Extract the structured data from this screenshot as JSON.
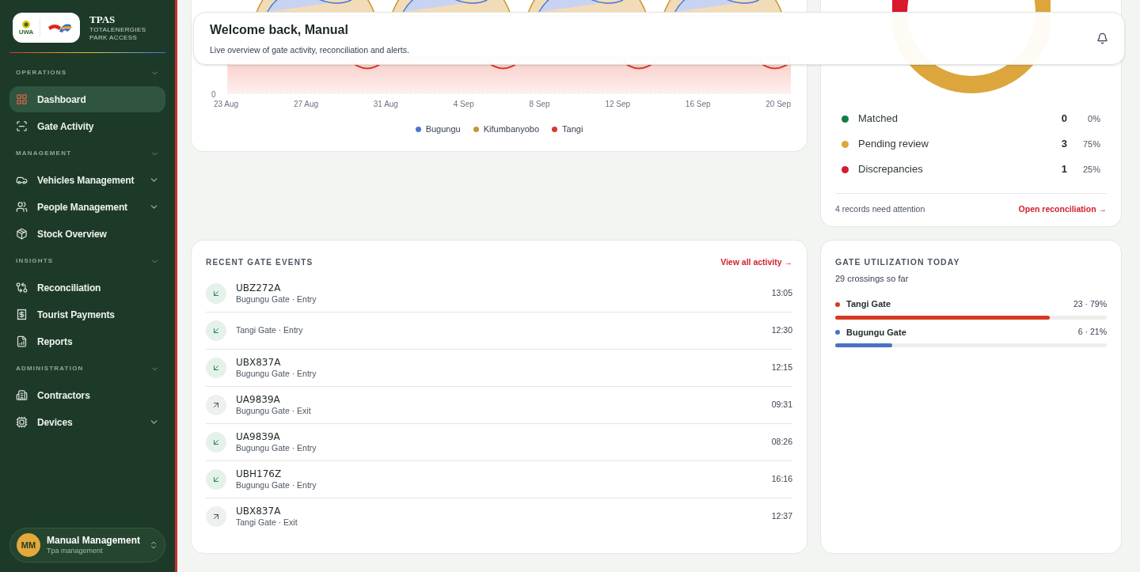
{
  "brand": {
    "logo_text": "UWA",
    "title": "TPAS",
    "subtitle": "TOTALENERGIES PARK ACCESS"
  },
  "sidebar": {
    "sections": [
      {
        "title": "OPERATIONS",
        "expanded": true,
        "items": [
          {
            "label": "Dashboard",
            "selected": true
          },
          {
            "label": "Gate Activity",
            "selected": false
          }
        ]
      },
      {
        "title": "MANAGEMENT",
        "expanded": true,
        "items": [
          {
            "label": "Vehicles Management",
            "selected": false,
            "expanded": false
          },
          {
            "label": "People Management",
            "selected": false,
            "expanded": false
          },
          {
            "label": "Stock Overview",
            "selected": false
          }
        ]
      },
      {
        "title": "INSIGHTS",
        "expanded": true,
        "items": [
          {
            "label": "Reconciliation",
            "selected": false
          },
          {
            "label": "Tourist Payments",
            "selected": false
          },
          {
            "label": "Reports",
            "selected": false
          }
        ]
      },
      {
        "title": "ADMINISTRATION",
        "expanded": true,
        "items": [
          {
            "label": "Contractors",
            "selected": false
          },
          {
            "label": "Devices",
            "selected": false,
            "expanded": false
          }
        ]
      }
    ],
    "user": {
      "initials": "MM",
      "name": "Manual Management",
      "role": "Tpa management"
    }
  },
  "header": {
    "title": "Welcome back, Manual",
    "subtitle": "Live overview of gate activity, reconciliation and alerts."
  },
  "activity_chart": {
    "y_tick": "0",
    "x_labels": [
      "23 Aug",
      "27 Aug",
      "31 Aug",
      "4 Sep",
      "8 Sep",
      "12 Sep",
      "16 Sep",
      "20 Sep"
    ],
    "legend": [
      {
        "label": "Bugungu",
        "color": "#4a78c9"
      },
      {
        "label": "Kifumbanyobo",
        "color": "#c9962e"
      },
      {
        "label": "Tangi",
        "color": "#d63a2a"
      }
    ]
  },
  "reconciliation": {
    "rows": [
      {
        "label": "Matched",
        "count": "0",
        "percent": "0%",
        "color": "#157a4a"
      },
      {
        "label": "Pending review",
        "count": "3",
        "percent": "75%",
        "color": "#dca63c"
      },
      {
        "label": "Discrepancies",
        "count": "1",
        "percent": "25%",
        "color": "#d8192e"
      }
    ],
    "note": "4 records need attention",
    "link": "Open reconciliation →"
  },
  "recent_events": {
    "title": "RECENT GATE EVENTS",
    "link": "View all activity →",
    "events": [
      {
        "kind": "entry",
        "plate": "UBZ272A",
        "detail": "Bugungu Gate · Entry",
        "time": "13:05"
      },
      {
        "kind": "entry",
        "detail": "Tangi Gate · Entry",
        "time": "12:30"
      },
      {
        "kind": "entry",
        "plate": "UBX837A",
        "detail": "Bugungu Gate · Entry",
        "time": "12:15"
      },
      {
        "kind": "exit",
        "plate": "UA9839A",
        "detail": "Bugungu Gate · Exit",
        "time": "09:31"
      },
      {
        "kind": "entry",
        "plate": "UA9839A",
        "detail": "Bugungu Gate · Entry",
        "time": "08:26"
      },
      {
        "kind": "entry",
        "plate": "UBH176Z",
        "detail": "Bugungu Gate · Entry",
        "time": "16:16"
      },
      {
        "kind": "exit",
        "plate": "UBX837A",
        "detail": "Tangi Gate · Exit",
        "time": "12:37"
      }
    ]
  },
  "utilization": {
    "title": "GATE UTILIZATION TODAY",
    "subtitle": "29 crossings so far",
    "gates": [
      {
        "label": "Tangi Gate",
        "reading": "23 · 79%",
        "level": 0.79,
        "color": "#d63a22"
      },
      {
        "label": "Bugungu Gate",
        "reading": "6 · 21%",
        "level": 0.21,
        "color": "#4a72c4"
      }
    ]
  }
}
